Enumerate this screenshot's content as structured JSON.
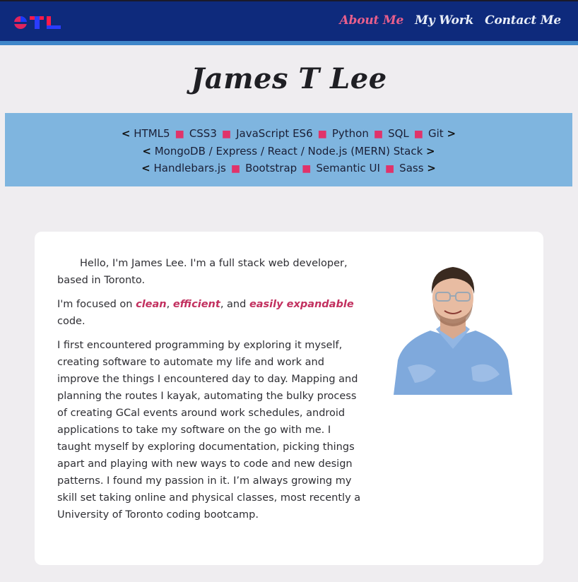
{
  "nav": {
    "links": [
      "About Me",
      "My Work",
      "Contact Me"
    ],
    "active_index": 0
  },
  "page": {
    "title": "James T Lee"
  },
  "skills": {
    "row1": [
      "HTML5",
      "CSS3",
      "JavaScript ES6",
      "Python",
      "SQL",
      "Git"
    ],
    "row2": [
      "MongoDB / Express / React / Node.js (MERN) Stack"
    ],
    "row3": [
      "Handlebars.js",
      "Bootstrap",
      "Semantic UI",
      "Sass"
    ]
  },
  "about": {
    "p1": "Hello, I'm James Lee. I'm a full stack web developer, based in Toronto.",
    "p2_prefix": "I'm focused on ",
    "p2_word1": "clean",
    "p2_sep1": ", ",
    "p2_word2": "efficient",
    "p2_sep2": ", and ",
    "p2_word3": "easily expandable",
    "p2_suffix": " code.",
    "p3": "I first encountered programming by exploring it myself, creating software to automate my life and work and improve the things I encountered day to day. Mapping and planning the routes I kayak, automating the bulky process of creating GCal events around work schedules, android applications to take my software on the go with me. I taught myself by exploring documentation, picking things apart and playing with new ways to code and new design patterns. I found my passion in it. I’m always growing my skill set taking online and physical classes, most recently a University of Toronto coding bootcamp."
  },
  "colors": {
    "navbar": "#0e2a7c",
    "accent_pink": "#e95f8c",
    "skills_band": "#7fb5df",
    "highlight": "#c2305f"
  }
}
